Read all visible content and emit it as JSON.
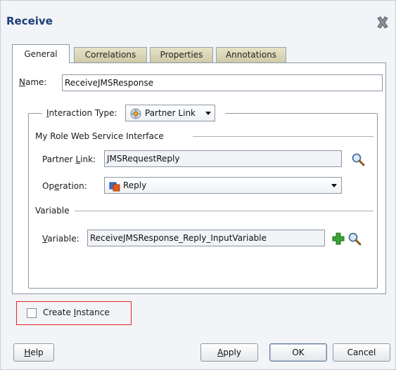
{
  "dialog": {
    "title": "Receive",
    "close_icon": "close-x-icon"
  },
  "tabs": [
    {
      "label": "General",
      "active": true
    },
    {
      "label": "Correlations",
      "active": false
    },
    {
      "label": "Properties",
      "active": false
    },
    {
      "label": "Annotations",
      "active": false
    }
  ],
  "general": {
    "name_label_first": "N",
    "name_label_rest": "ame:",
    "name_value": "ReceiveJMSResponse",
    "interaction": {
      "label_first": "I",
      "label_rest": "nteraction Type:",
      "value": "Partner Link",
      "icon": "partner-link-icon"
    },
    "my_role": {
      "header": "My Role Web Service Interface",
      "partner_link_label_pre": "Partner ",
      "partner_link_label_u": "L",
      "partner_link_label_post": "ink:",
      "partner_link_value": "JMSRequestReply",
      "operation_label_pre": "Op",
      "operation_label_u": "e",
      "operation_label_post": "ration:",
      "operation_value": "Reply",
      "operation_icon": "operation-icon"
    },
    "variable": {
      "header": "Variable",
      "label_u": "V",
      "label_rest": "ariable:",
      "value": "ReceiveJMSResponse_Reply_InputVariable"
    },
    "create_instance": {
      "label_pre": "Create ",
      "label_u": "I",
      "label_post": "nstance",
      "checked": false
    }
  },
  "buttons": {
    "help_u": "H",
    "help_rest": "elp",
    "apply_u": "A",
    "apply_rest": "pply",
    "ok": "OK",
    "cancel": "Cancel"
  },
  "colors": {
    "title": "#1b3c78",
    "highlight_border": "#e0262b",
    "add_icon_green": "#3aa335"
  }
}
